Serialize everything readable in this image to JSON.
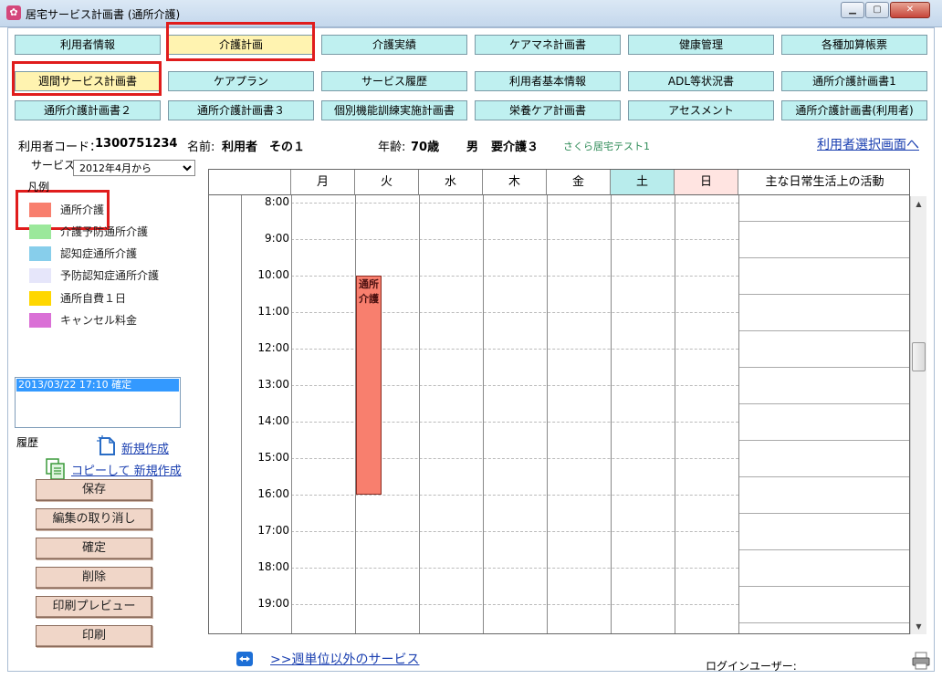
{
  "window": {
    "title": "居宅サービス計画書 (通所介護)",
    "icon_label": "✿"
  },
  "nav": {
    "row1": [
      "利用者情報",
      "介護計画",
      "介護実績",
      "ケアマネ計画書",
      "健康管理",
      "各種加算帳票"
    ],
    "row2": [
      "週間サービス計画書",
      "ケアプラン",
      "サービス履歴",
      "利用者基本情報",
      "ADL等状況書",
      "通所介護計画書1"
    ],
    "row3": [
      "通所介護計画書２",
      "通所介護計画書３",
      "個別機能訓練実施計画書",
      "栄養ケア計画書",
      "アセスメント",
      "通所介護計画書(利用者)"
    ]
  },
  "user": {
    "code_label": "利用者コード：",
    "code": "1300751234",
    "name_label": "名前:",
    "name": "利用者　その１",
    "age_label": "年齢:",
    "age": "70歳",
    "gender": "男",
    "care_level": "要介護３",
    "facility": "さくら居宅テスト1",
    "select_link": "利用者選択画面へ"
  },
  "service": {
    "label": "サービス",
    "selected": "2012年4月から"
  },
  "legend": {
    "title": "凡例",
    "items": [
      {
        "label": "通所介護",
        "color": "#f87f6e"
      },
      {
        "label": "介護予防通所介護",
        "color": "#9be89b"
      },
      {
        "label": "認知症通所介護",
        "color": "#87ceeb"
      },
      {
        "label": "予防認知症通所介護",
        "color": "#e6e6fa"
      },
      {
        "label": "通所自費１日",
        "color": "#ffd700"
      },
      {
        "label": "キャンセル料金",
        "color": "#da70d6"
      }
    ]
  },
  "history": {
    "entries": [
      "2013/03/22 17:10 確定"
    ],
    "label": "履歴",
    "new_link": "新規作成",
    "copy_link": "コピーして 新規作成"
  },
  "actions": [
    "保存",
    "編集の取り消し",
    "確定",
    "削除",
    "印刷プレビュー",
    "印刷"
  ],
  "schedule": {
    "days": [
      "月",
      "火",
      "水",
      "木",
      "金",
      "土",
      "日"
    ],
    "activities_header": "主な日常生活上の活動",
    "times": [
      "8:00",
      "9:00",
      "10:00",
      "11:00",
      "12:00",
      "13:00",
      "14:00",
      "15:00",
      "16:00",
      "17:00",
      "18:00",
      "19:00"
    ],
    "events": [
      {
        "day": "火",
        "label": "通所介護",
        "start": "10:00",
        "end": "16:00",
        "color": "#f87f6e"
      }
    ],
    "day_colors": {
      "土": "#b8ecec",
      "日": "#ffe4e1"
    }
  },
  "footer": {
    "other_services_link": ">>週単位以外のサービス",
    "login_user_label": "ログインユーザー:"
  }
}
